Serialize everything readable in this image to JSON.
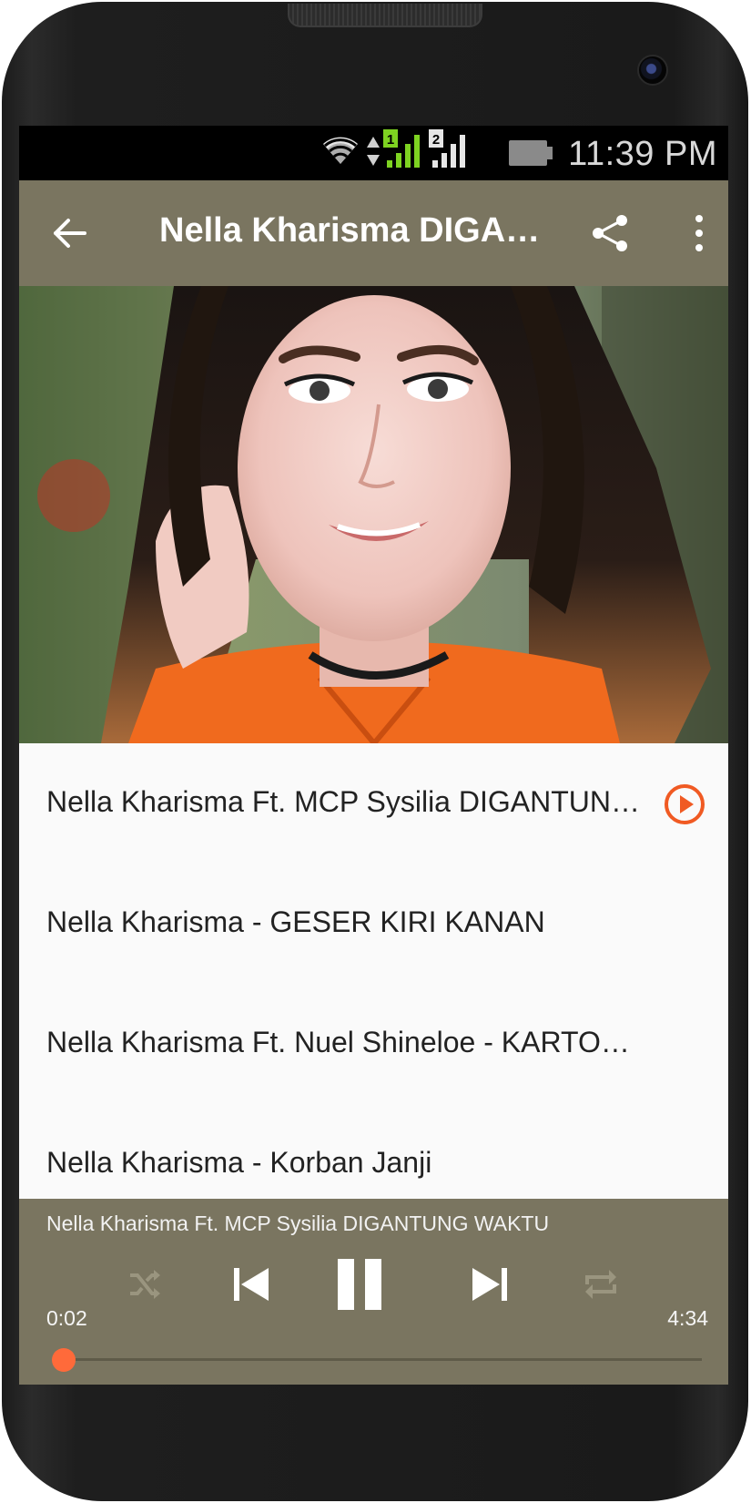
{
  "status_bar": {
    "time": "11:39 PM",
    "icons": [
      "wifi-icon",
      "data-arrows-icon",
      "sim1-signal-icon",
      "sim2-signal-icon",
      "battery-icon"
    ],
    "sim1_label": "1",
    "sim2_label": "2"
  },
  "app_bar": {
    "title": "Nella Kharisma DIGANTUNG WAKTU",
    "back_icon": "arrow-back-icon",
    "share_icon": "share-icon",
    "menu_icon": "more-vert-icon"
  },
  "album_art": {
    "description_icon": "album-art-photo"
  },
  "tracks": [
    {
      "title": "Nella Kharisma Ft. MCP Sysilia DIGANTUNG WAKTU",
      "playing": true
    },
    {
      "title": "Nella Kharisma - GESER KIRI KANAN",
      "playing": false
    },
    {
      "title": "Nella Kharisma Ft. Nuel Shineloe - KARTONYONO MEDOT JANJI",
      "playing": false
    },
    {
      "title": "Nella Kharisma - Korban Janji",
      "playing": false
    }
  ],
  "player": {
    "now_playing": "Nella Kharisma Ft. MCP Sysilia DIGANTUNG WAKTU",
    "elapsed": "0:02",
    "duration": "4:34",
    "progress": 0.007,
    "controls": [
      "shuffle-icon",
      "skip-previous-icon",
      "pause-icon",
      "skip-next-icon",
      "repeat-icon"
    ]
  },
  "colors": {
    "primary": "#7a7560",
    "accent": "#ff5a2b",
    "list_bg": "#fafafa"
  }
}
